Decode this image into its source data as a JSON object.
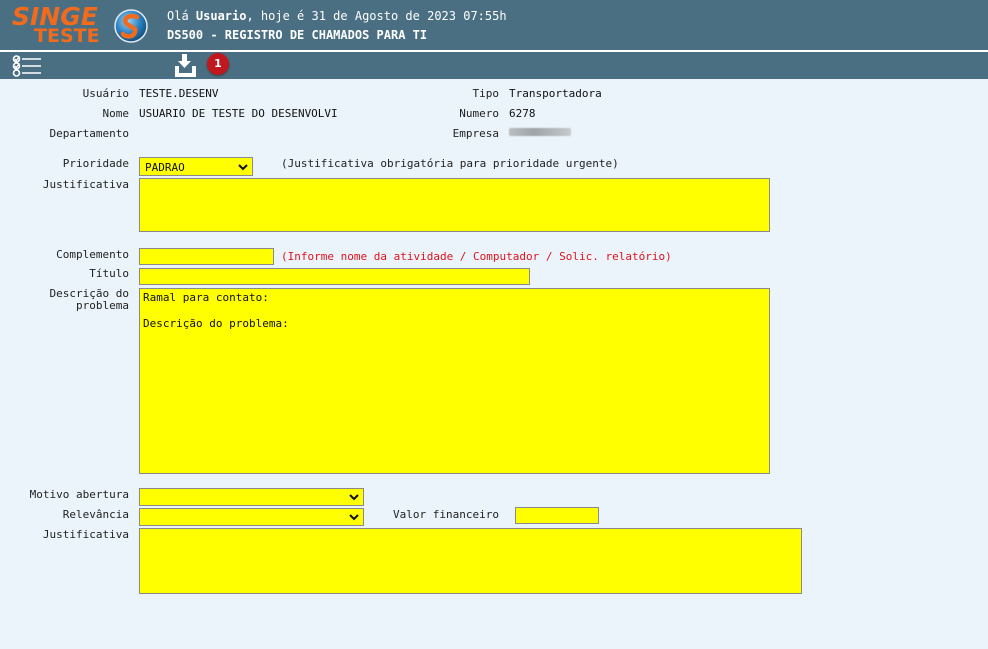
{
  "header": {
    "logo_word": "SINGE",
    "logo_sub": "TESTE",
    "greeting_prefix": "Olá ",
    "greeting_user": "Usuario",
    "greeting_suffix": ", hoje é 31 de Agosto de 2023 07:55h",
    "screen_title": "DS500 - REGISTRO DE CHAMADOS PARA TI",
    "brand_color": "#f26b1d",
    "bar_color": "#4b6f82"
  },
  "toolbar": {
    "menu_icon": "checklist-menu-icon",
    "save_icon": "download-save-icon",
    "badge_count": "1"
  },
  "info": {
    "usuario_label": "Usuário",
    "usuario_value": "TESTE.DESENV",
    "nome_label": "Nome",
    "nome_value": "USUARIO DE TESTE DO DESENVOLVI",
    "departamento_label": "Departamento",
    "tipo_label": "Tipo",
    "tipo_value": "Transportadora",
    "numero_label": "Numero",
    "numero_value": "6278",
    "empresa_label": "Empresa"
  },
  "form": {
    "prioridade_label": "Prioridade",
    "prioridade_value": "PADRAO",
    "prioridade_note": "(Justificativa obrigatória para prioridade urgente)",
    "justificativa_label": "Justificativa",
    "complemento_label": "Complemento",
    "complemento_note": "(Informe nome da atividade / Computador / Solic. relatório)",
    "titulo_label": "Título",
    "descricao_label_1": "Descrição do",
    "descricao_label_2": "problema",
    "descricao_value": "Ramal para contato:\n\nDescrição do problema:",
    "motivo_label": "Motivo abertura",
    "relevancia_label": "Relevância",
    "valor_label": "Valor financeiro",
    "justificativa2_label": "Justificativa",
    "field_color": "#ffff00",
    "note_color": "#e0121b"
  }
}
